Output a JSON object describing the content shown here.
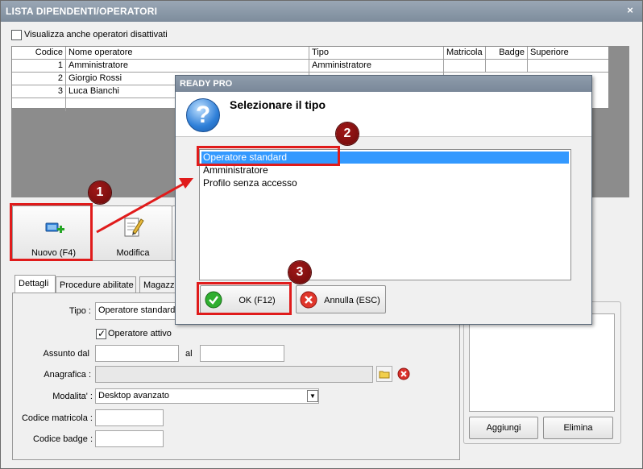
{
  "main_window": {
    "title": "LISTA DIPENDENTI/OPERATORI",
    "close_glyph": "×",
    "show_disabled_label": "Visualizza anche operatori disattivati",
    "grid": {
      "columns": [
        "Codice",
        "Nome operatore",
        "Tipo",
        "Matricola",
        "Badge",
        "Superiore"
      ],
      "rows": [
        {
          "codice": "1",
          "nome": "Amministratore",
          "tipo": "Amministratore"
        },
        {
          "codice": "2",
          "nome": "Giorgio Rossi",
          "tipo": ""
        },
        {
          "codice": "3",
          "nome": "Luca Bianchi",
          "tipo": ""
        }
      ]
    },
    "toolbar": {
      "new_label": "Nuovo (F4)",
      "edit_label": "Modifica"
    },
    "tabs": [
      "Dettagli",
      "Procedure abilitate",
      "Magazzi"
    ],
    "form": {
      "tipo_label": "Tipo :",
      "tipo_value": "Operatore standard",
      "active_label": "Operatore attivo",
      "assunto_label": "Assunto dal",
      "al_label": "al",
      "anagrafica_label": "Anagrafica :",
      "modalita_label": "Modalita' :",
      "modalita_value": "Desktop avanzato",
      "matricola_label": "Codice matricola :",
      "badge_label": "Codice badge :"
    },
    "side_panel": {
      "add_label": "Aggiungi",
      "delete_label": "Elimina"
    }
  },
  "dialog": {
    "title": "READY PRO",
    "prompt": "Selezionare il tipo",
    "question_glyph": "?",
    "options": [
      "Operatore standard",
      "Amministratore",
      "Profilo senza accesso"
    ],
    "selected_index": 0,
    "ok_label": "OK (F12)",
    "cancel_label": "Annulla (ESC)"
  },
  "annotations": {
    "badge1": "1",
    "badge2": "2",
    "badge3": "3"
  },
  "colors": {
    "annotation_red": "#e01b1b",
    "selection_blue": "#3399ff",
    "badge_dark_red": "#7a0f0f"
  }
}
